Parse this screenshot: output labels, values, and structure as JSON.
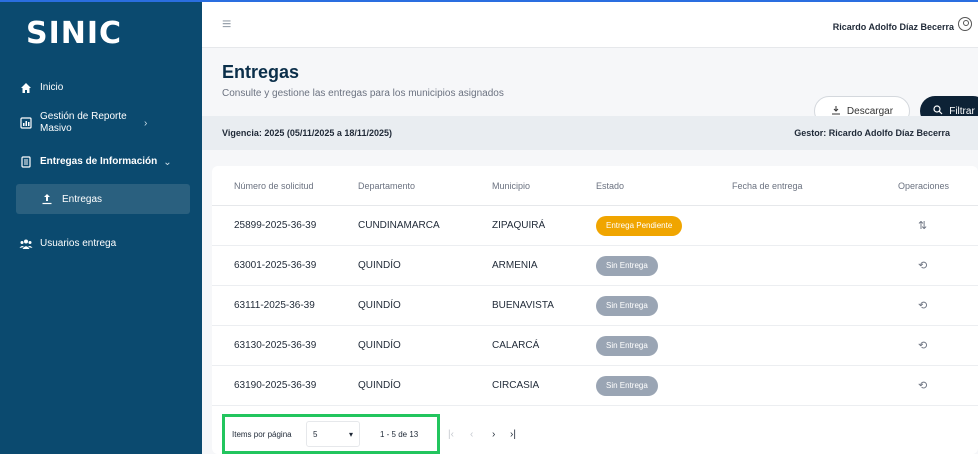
{
  "sidebar": {
    "logo": "SINIC",
    "items": [
      {
        "label": "Inicio",
        "icon": "home-icon"
      },
      {
        "label": "Gestión de Reporte Masivo",
        "icon": "report-icon"
      },
      {
        "label": "Entregas de Información",
        "icon": "document-icon"
      },
      {
        "label": "Entregas",
        "icon": "upload-icon"
      },
      {
        "label": "Usuarios entrega",
        "icon": "users-icon"
      }
    ]
  },
  "header": {
    "user_name": "Ricardo Adolfo Díaz Becerra"
  },
  "page": {
    "title": "Entregas",
    "subtitle": "Consulte y gestione las entregas para los municipios asignados",
    "download_label": "Descargar",
    "filter_label": "Filtrar",
    "vigencia": "Vigencia: 2025 (05/11/2025 a 18/11/2025)",
    "gestor": "Gestor: Ricardo Adolfo Díaz Becerra"
  },
  "table": {
    "columns": [
      "Número de solicitud",
      "Departamento",
      "Municipio",
      "Estado",
      "Fecha de entrega",
      "Operaciones"
    ],
    "rows": [
      {
        "solicitud": "25899-2025-36-39",
        "departamento": "CUNDINAMARCA",
        "municipio": "ZIPAQUIRÁ",
        "estado": "Entrega Pendiente",
        "fecha": "",
        "op_icon": "transfer-icon"
      },
      {
        "solicitud": "63001-2025-36-39",
        "departamento": "QUINDÍO",
        "municipio": "ARMENIA",
        "estado": "Sin Entrega",
        "fecha": "",
        "op_icon": "history-icon"
      },
      {
        "solicitud": "63111-2025-36-39",
        "departamento": "QUINDÍO",
        "municipio": "BUENAVISTA",
        "estado": "Sin Entrega",
        "fecha": "",
        "op_icon": "history-icon"
      },
      {
        "solicitud": "63130-2025-36-39",
        "departamento": "QUINDÍO",
        "municipio": "CALARCÁ",
        "estado": "Sin Entrega",
        "fecha": "",
        "op_icon": "history-icon"
      },
      {
        "solicitud": "63190-2025-36-39",
        "departamento": "QUINDÍO",
        "municipio": "CIRCASIA",
        "estado": "Sin Entrega",
        "fecha": "",
        "op_icon": "history-icon"
      }
    ]
  },
  "pager": {
    "items_label": "Items por página",
    "page_size": "5",
    "range": "1 - 5 de 13"
  },
  "colors": {
    "sidebar_bg": "#0b4a6f",
    "pending": "#f0a500",
    "no_delivery": "#9aa5b4",
    "highlight": "#22c55e"
  }
}
